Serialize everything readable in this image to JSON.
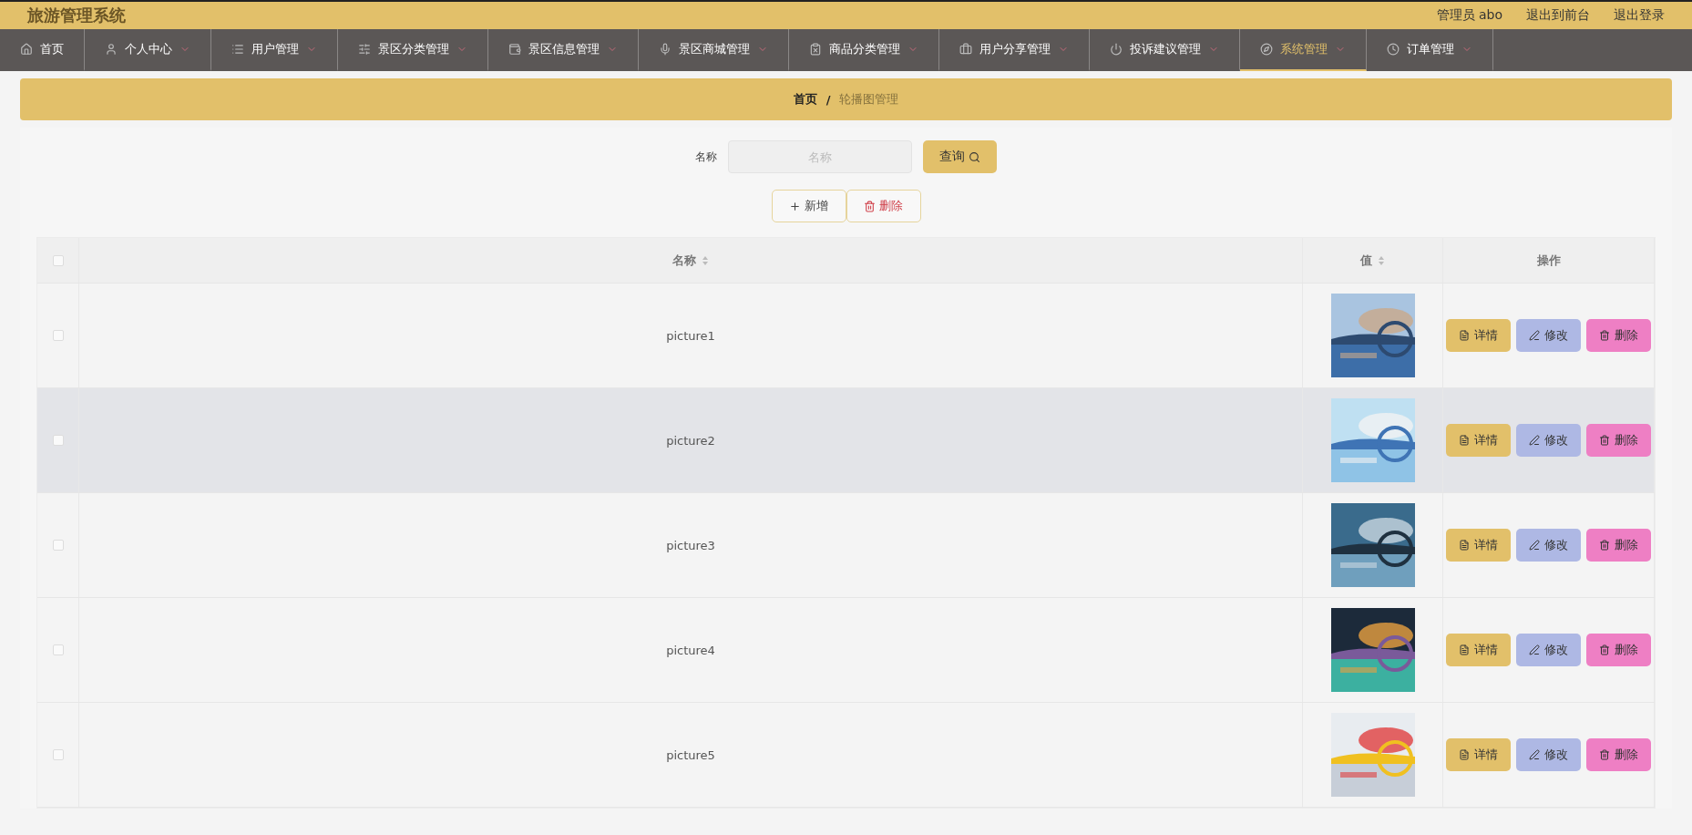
{
  "header": {
    "title": "旅游管理系统",
    "user": "管理员 abo",
    "links": [
      "退出到前台",
      "退出登录"
    ]
  },
  "nav": [
    {
      "label": "首页",
      "dropdown": false,
      "selected": false
    },
    {
      "label": "个人中心",
      "dropdown": true,
      "selected": false
    },
    {
      "label": "用户管理",
      "dropdown": true,
      "selected": false
    },
    {
      "label": "景区分类管理",
      "dropdown": true,
      "selected": false
    },
    {
      "label": "景区信息管理",
      "dropdown": true,
      "selected": false
    },
    {
      "label": "景区商城管理",
      "dropdown": true,
      "selected": false
    },
    {
      "label": "商品分类管理",
      "dropdown": true,
      "selected": false
    },
    {
      "label": "用户分享管理",
      "dropdown": true,
      "selected": false
    },
    {
      "label": "投诉建议管理",
      "dropdown": true,
      "selected": false
    },
    {
      "label": "系统管理",
      "dropdown": true,
      "selected": true
    },
    {
      "label": "订单管理",
      "dropdown": true,
      "selected": false
    }
  ],
  "breadcrumb": [
    "首页",
    "/",
    "轮播图管理"
  ],
  "search": {
    "label": "名称",
    "placeholder": "名称",
    "button": "查询"
  },
  "actions": {
    "add": "新增",
    "delete": "删除"
  },
  "table": {
    "all_checked": false,
    "columns": [
      "名称",
      "值",
      "操作"
    ],
    "rows": [
      {
        "name": "picture1",
        "checked": false,
        "hovered": false,
        "buttons": [
          "详情",
          "修改",
          "删除"
        ]
      },
      {
        "name": "picture2",
        "checked": false,
        "hovered": true,
        "buttons": [
          "详情",
          "修改",
          "删除"
        ]
      },
      {
        "name": "picture3",
        "checked": false,
        "hovered": false,
        "buttons": [
          "详情",
          "修改",
          "删除"
        ]
      },
      {
        "name": "picture4",
        "checked": false,
        "hovered": false,
        "buttons": [
          "详情",
          "修改",
          "删除"
        ]
      },
      {
        "name": "picture5",
        "checked": false,
        "hovered": false,
        "buttons": [
          "详情",
          "修改",
          "删除"
        ]
      }
    ]
  }
}
